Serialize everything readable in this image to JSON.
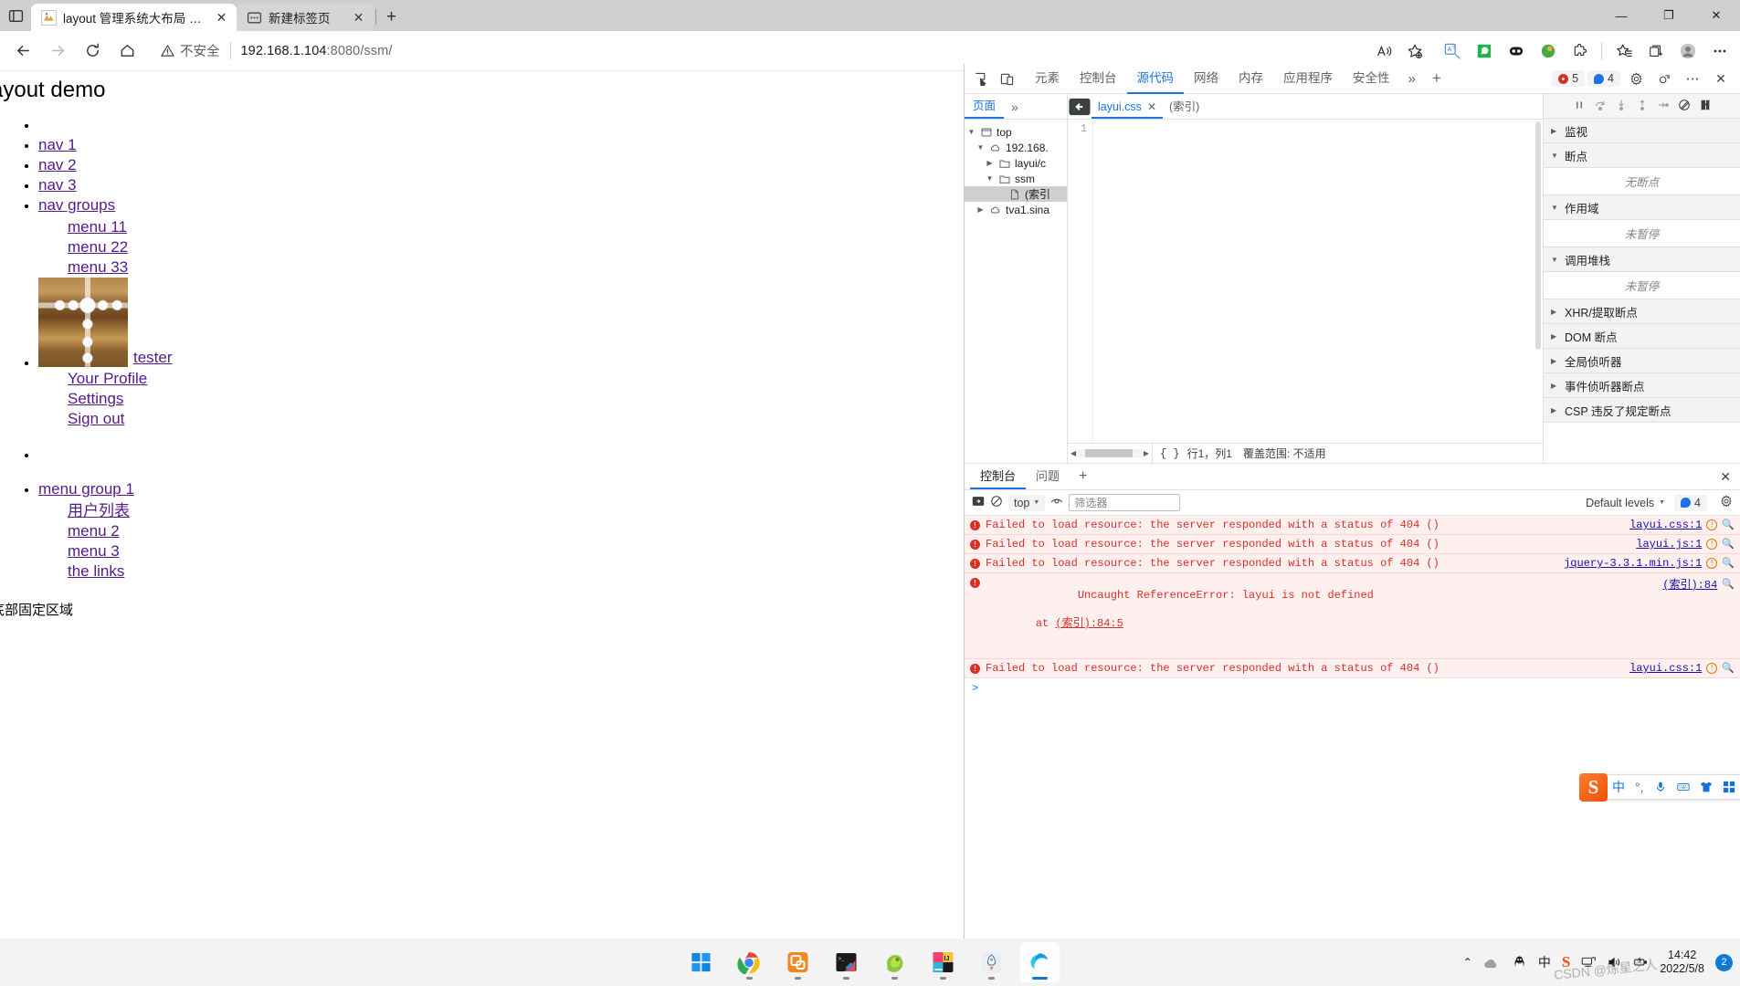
{
  "browser": {
    "tabs": [
      {
        "title": "layout 管理系统大布局 - Layui",
        "favicon": "layui-icon",
        "active": true,
        "close_label": "✕"
      },
      {
        "title": "新建标签页",
        "favicon": "newtab-icon",
        "active": false,
        "close_label": "✕"
      }
    ],
    "new_tab_label": "+",
    "window_controls": {
      "minimize": "—",
      "maximize": "❐",
      "close": "✕"
    },
    "nav": {
      "back": "←",
      "forward": "→",
      "reload": "⟳",
      "home": "⌂"
    },
    "omnibox": {
      "security_label": "不安全",
      "url_host": "192.168.1.104",
      "url_rest": ":8080/ssm/"
    },
    "toolbar_icons": [
      "read-aloud-icon",
      "add-favorite-icon",
      "translate-icon",
      "whatsapp-icon",
      "extension-dark-icon",
      "idm-icon",
      "extensions-icon",
      "favorites-icon",
      "collections-icon",
      "profile-icon",
      "settings-more-icon"
    ]
  },
  "page": {
    "heading": "ayout demo",
    "nav_items": [
      {
        "label": "",
        "empty": true
      },
      {
        "label": "nav 1"
      },
      {
        "label": "nav 2"
      },
      {
        "label": "nav 3"
      },
      {
        "label": "nav groups"
      }
    ],
    "nav_group_children": [
      "menu 11",
      "menu 22",
      "menu 33"
    ],
    "user": {
      "name": "tester",
      "avatar": "user-avatar"
    },
    "user_menu": [
      "Your Profile",
      "Settings",
      "Sign out"
    ],
    "menu_group": {
      "label": "menu group 1",
      "children": [
        "用户列表",
        "menu 2",
        "menu 3",
        "the links"
      ]
    },
    "footer_text": "底部固定区域"
  },
  "devtools": {
    "top_tabs": [
      {
        "label": "元素",
        "active": false
      },
      {
        "label": "控制台",
        "active": false
      },
      {
        "label": "源代码",
        "active": true
      },
      {
        "label": "网络",
        "active": false
      },
      {
        "label": "内存",
        "active": false
      },
      {
        "label": "应用程序",
        "active": false
      },
      {
        "label": "安全性",
        "active": false
      }
    ],
    "more_tabs_label": "»",
    "add_tab_label": "+",
    "error_count": "5",
    "info_count": "4",
    "settings_icon": "gear-icon",
    "customize_icon": "feedback-icon",
    "more_icon": "⋯",
    "close_icon": "✕",
    "sources": {
      "nav_tab": "页面",
      "nav_more": "»",
      "tree": [
        {
          "label": "top",
          "depth": 0,
          "twisty": "▼",
          "icon": "frame-icon"
        },
        {
          "label": "192.168.",
          "depth": 1,
          "twisty": "▼",
          "icon": "cloud-icon"
        },
        {
          "label": "layui/c",
          "depth": 2,
          "twisty": "▶",
          "icon": "folder-icon"
        },
        {
          "label": "ssm",
          "depth": 2,
          "twisty": "▼",
          "icon": "folder-icon"
        },
        {
          "label": "(索引",
          "depth": 3,
          "twisty": "",
          "icon": "file-icon",
          "selected": true
        },
        {
          "label": "tva1.sina",
          "depth": 1,
          "twisty": "▶",
          "icon": "cloud-icon"
        }
      ],
      "editor_tabs": [
        {
          "label": "layui.css",
          "active": true,
          "close": "✕"
        },
        {
          "label": "(索引)",
          "active": false
        }
      ],
      "gutter_line": "1",
      "status": {
        "brace": "{ }",
        "position": "行1，列1",
        "coverage": "覆盖范围: 不适用"
      }
    },
    "debugger": {
      "controls": [
        "pause-icon",
        "step-over-icon",
        "step-into-icon",
        "step-out-icon",
        "step-icon",
        "deactivate-breakpoints-icon",
        "pause-on-exceptions-icon"
      ],
      "sections": [
        {
          "label": "监视",
          "twisty": "▶",
          "body": null
        },
        {
          "label": "断点",
          "twisty": "▼",
          "body": "无断点"
        },
        {
          "label": "作用域",
          "twisty": "▼",
          "body": "未暂停"
        },
        {
          "label": "调用堆栈",
          "twisty": "▼",
          "body": "未暂停"
        },
        {
          "label": "XHR/提取断点",
          "twisty": "▶",
          "body": null
        },
        {
          "label": "DOM 断点",
          "twisty": "▶",
          "body": null
        },
        {
          "label": "全局侦听器",
          "twisty": "▶",
          "body": null
        },
        {
          "label": "事件侦听器断点",
          "twisty": "▶",
          "body": null
        },
        {
          "label": "CSP 违反了规定断点",
          "twisty": "▶",
          "body": null
        }
      ]
    },
    "console": {
      "tabs": [
        {
          "label": "控制台",
          "active": true
        },
        {
          "label": "问题",
          "active": false
        }
      ],
      "add_label": "+",
      "close_label": "✕",
      "sidebar_icon": "show-sidebar-icon",
      "clear_icon": "clear-console-icon",
      "context": "top",
      "eye_icon": "live-expression-icon",
      "filter_placeholder": "筛选器",
      "levels_label": "Default levels",
      "issues_count": "4",
      "settings_icon": "gear-icon",
      "messages": [
        {
          "type": "error",
          "text": "Failed to load resource: the server responded with a status of 404 ()",
          "source": "layui.css:1",
          "sub": null,
          "sub_link": null
        },
        {
          "type": "error",
          "text": "Failed to load resource: the server responded with a status of 404 ()",
          "source": "layui.js:1",
          "sub": null,
          "sub_link": null
        },
        {
          "type": "error",
          "text": "Failed to load resource: the server responded with a status of 404 ()",
          "source": "jquery-3.3.1.min.js:1",
          "sub": null,
          "sub_link": null
        },
        {
          "type": "error",
          "text": "Uncaught ReferenceError: layui is not defined",
          "source": "(索引):84",
          "sub": "    at ",
          "sub_link": "(索引):84:5"
        },
        {
          "type": "error",
          "text": "Failed to load resource: the server responded with a status of 404 ()",
          "source": "layui.css:1",
          "sub": null,
          "sub_link": null
        }
      ],
      "prompt": ">"
    }
  },
  "ime": {
    "logo": "S",
    "items": [
      "中",
      "°,",
      "mic-icon",
      "keyboard-icon",
      "skin-icon",
      "apps-icon"
    ]
  },
  "taskbar": {
    "apps": [
      {
        "name": "start-button",
        "running": false
      },
      {
        "name": "chrome-icon",
        "running": true
      },
      {
        "name": "vmware-icon",
        "running": true
      },
      {
        "name": "terminal-icon",
        "running": true
      },
      {
        "name": "navicat-icon",
        "running": true
      },
      {
        "name": "intellij-idea-icon",
        "running": true
      },
      {
        "name": "rocket-app-icon",
        "running": true
      },
      {
        "name": "edge-icon",
        "running": true,
        "active": true
      }
    ],
    "tray": {
      "overflow": "⌃",
      "cloud_icon": "onedrive-icon",
      "qq_icon": "qq-icon",
      "ime_label": "中",
      "sogou_label": "S",
      "network_icon": "network-icon",
      "volume_icon": "volume-icon",
      "battery_icon": "power-icon",
      "time": "14:42",
      "date": "2022/5/8",
      "notification_count": "2"
    },
    "watermark": "CSDN @炼星之人"
  }
}
